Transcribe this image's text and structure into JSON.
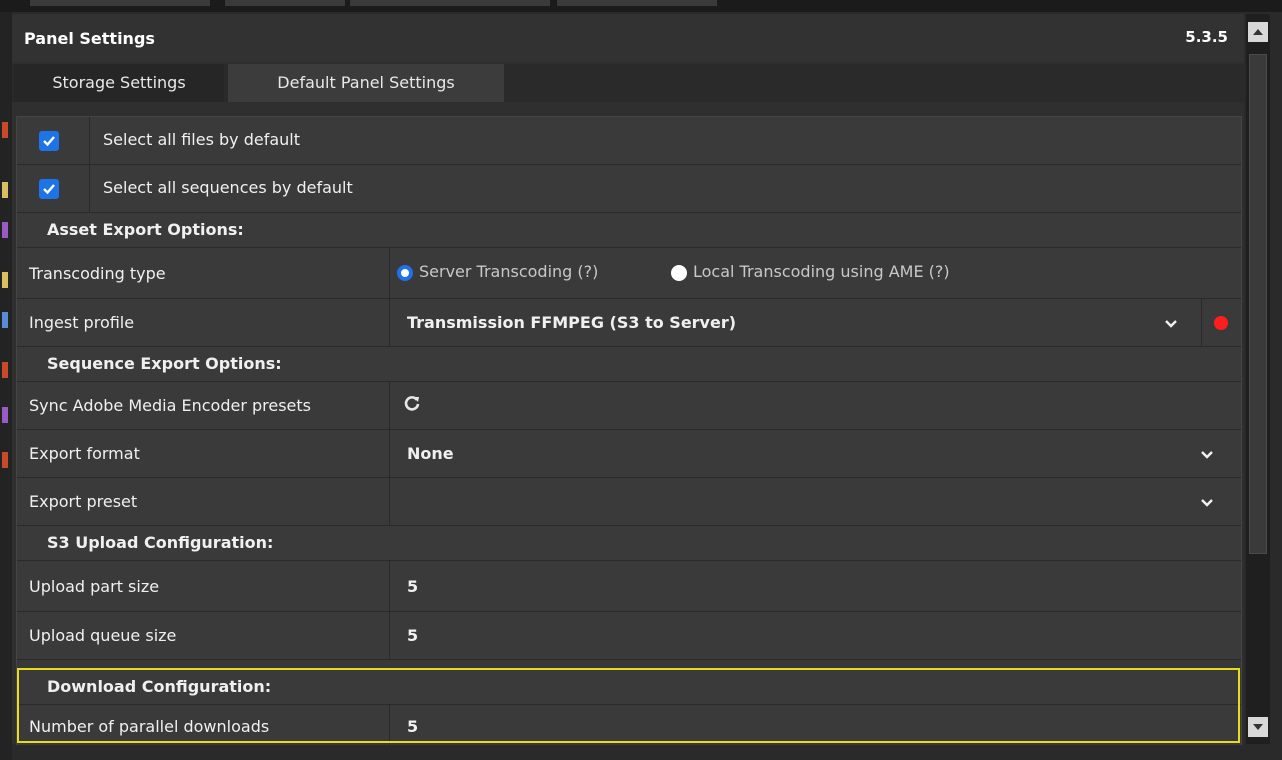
{
  "panel": {
    "title": "Panel Settings",
    "version": "5.3.5"
  },
  "tabs": [
    {
      "label": "Storage Settings",
      "active": true
    },
    {
      "label": "Default Panel Settings",
      "active": false
    }
  ],
  "checkboxes": [
    {
      "label": "Select all files by default",
      "checked": true
    },
    {
      "label": "Select all sequences by default",
      "checked": true
    }
  ],
  "asset_export": {
    "heading": "Asset Export Options:",
    "transcoding": {
      "label": "Transcoding type",
      "options": [
        "Server Transcoding (?)",
        "Local Transcoding using AME (?)"
      ],
      "selected": "Server Transcoding (?)"
    },
    "ingest": {
      "label": "Ingest profile",
      "value": "Transmission FFMPEG (S3 to Server)",
      "status_color": "#ff1e1e"
    }
  },
  "sequence_export": {
    "heading": "Sequence Export Options:",
    "sync": {
      "label": "Sync Adobe Media Encoder presets",
      "icon": "refresh-icon"
    },
    "format": {
      "label": "Export format",
      "value": "None"
    },
    "preset": {
      "label": "Export preset",
      "value": ""
    }
  },
  "s3_upload": {
    "heading": "S3 Upload Configuration:",
    "part_size": {
      "label": "Upload part size",
      "value": "5"
    },
    "queue_size": {
      "label": "Upload queue size",
      "value": "5"
    }
  },
  "download": {
    "heading": "Download Configuration:",
    "parallel": {
      "label": "Number of parallel downloads",
      "value": "5"
    }
  },
  "colors": {
    "accent": "#1e73e8",
    "highlight": "#e8dc1e",
    "status_red": "#ff1e1e"
  }
}
